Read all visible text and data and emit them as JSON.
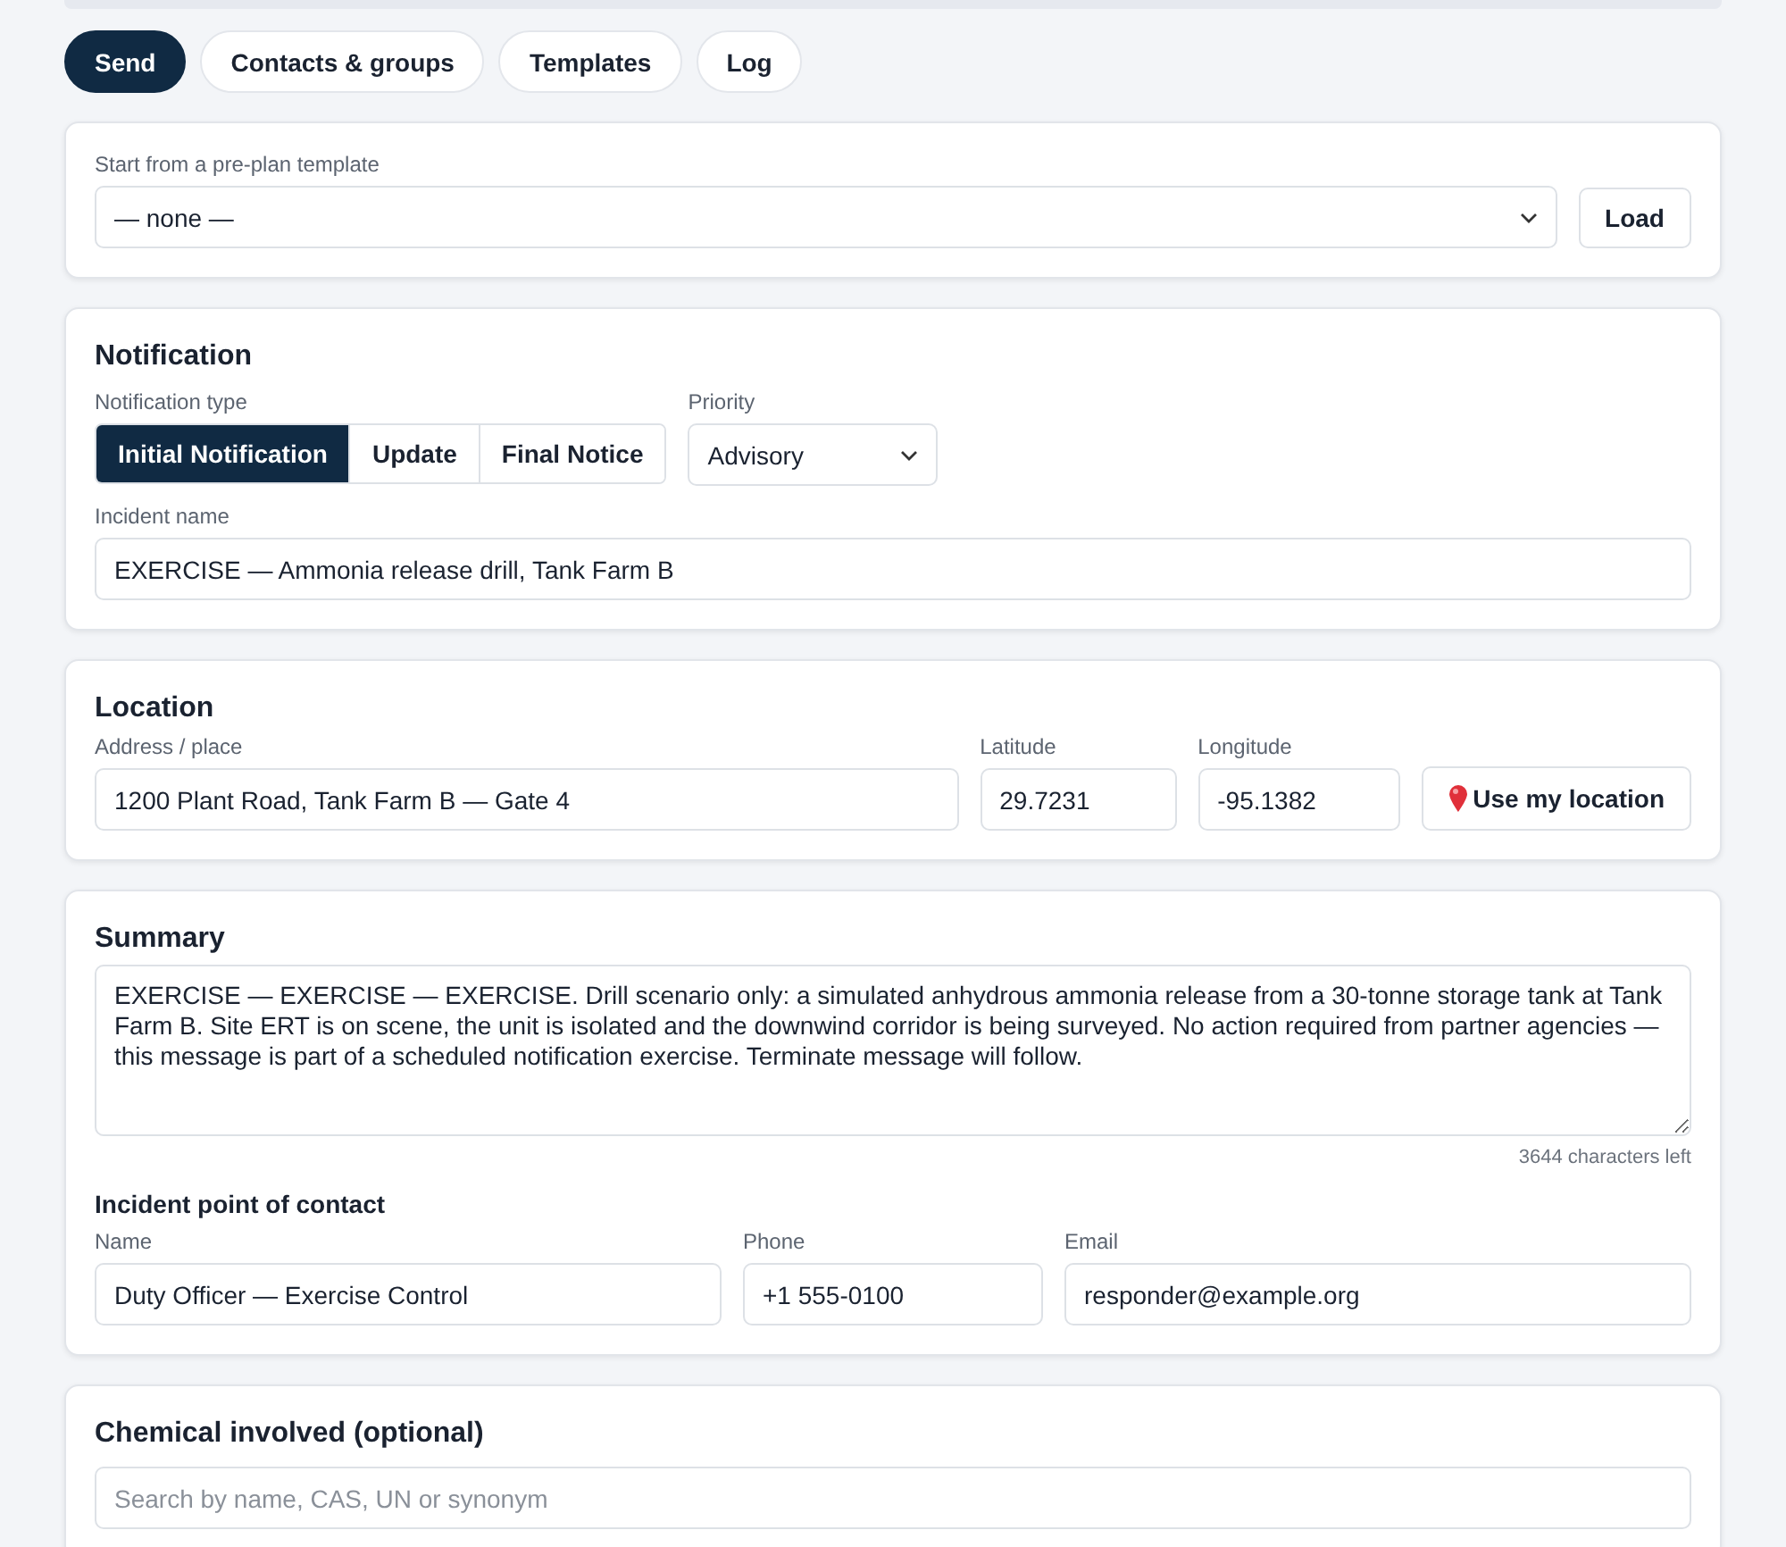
{
  "tabs": [
    {
      "label": "Send",
      "selected": true
    },
    {
      "label": "Contacts & groups",
      "selected": false
    },
    {
      "label": "Templates",
      "selected": false
    },
    {
      "label": "Log",
      "selected": false
    }
  ],
  "template": {
    "label": "Start from a pre-plan template",
    "value": "— none —",
    "button": "Load"
  },
  "notification": {
    "title": "Notification",
    "type_label": "Notification type",
    "types": [
      {
        "label": "Initial Notification",
        "selected": true
      },
      {
        "label": "Update",
        "selected": false
      },
      {
        "label": "Final Notice",
        "selected": false
      }
    ],
    "priority_label": "Priority",
    "priority_value": "Advisory",
    "incident_label": "Incident name",
    "incident_value": "EXERCISE — Ammonia release drill, Tank Farm B"
  },
  "location": {
    "title": "Location",
    "fields": [
      {
        "label": "Address / place",
        "value": "1200 Plant Road, Tank Farm B — Gate 4"
      },
      {
        "label": "Latitude",
        "value": "29.7231"
      },
      {
        "label": "Longitude",
        "value": "-95.1382"
      }
    ],
    "button": "Use my location"
  },
  "summary": {
    "title": "Summary",
    "text": "EXERCISE — EXERCISE — EXERCISE. Drill scenario only: a simulated anhydrous ammonia release from a 30-tonne storage tank at Tank Farm B. Site ERT is on scene, the unit is isolated and the downwind corridor is being surveyed. No action required from partner agencies — this message is part of a scheduled notification exercise. Terminate message will follow.",
    "chars_left": "3644 characters left",
    "contact": {
      "title": "Incident point of contact",
      "fields": [
        {
          "label": "Name",
          "value": "Duty Officer — Exercise Control"
        },
        {
          "label": "Phone",
          "value": "+1 555-0100"
        },
        {
          "label": "Email",
          "value": "responder@example.org"
        }
      ]
    }
  },
  "chemical": {
    "title": "Chemical involved (optional)",
    "search": {
      "placeholder": "Search by name, CAS, UN or synonym"
    }
  }
}
